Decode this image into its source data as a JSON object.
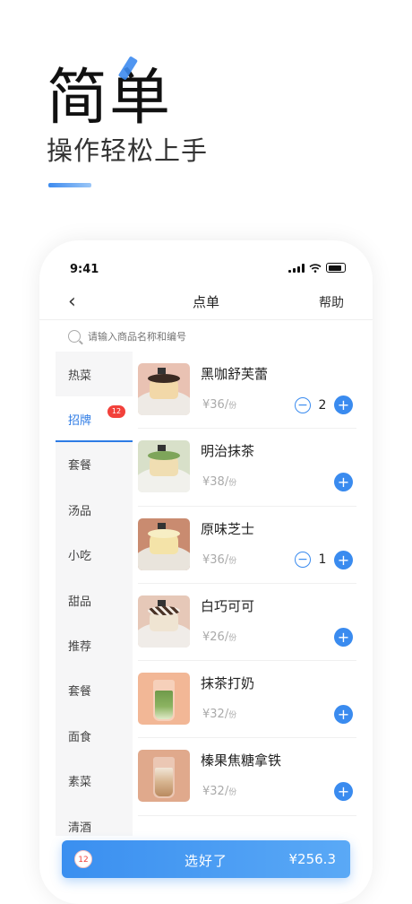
{
  "hero": {
    "title": "简单",
    "subtitle": "操作轻松上手"
  },
  "status": {
    "time": "9:41"
  },
  "nav": {
    "title": "点单",
    "help": "帮助"
  },
  "search": {
    "placeholder": "请输入商品名称和编号"
  },
  "categories": [
    {
      "label": "热菜"
    },
    {
      "label": "招牌",
      "badge": "12",
      "active": true
    },
    {
      "label": "套餐"
    },
    {
      "label": "汤品"
    },
    {
      "label": "小吃"
    },
    {
      "label": "甜品"
    },
    {
      "label": "推荐"
    },
    {
      "label": "套餐"
    },
    {
      "label": "面食"
    },
    {
      "label": "素菜"
    },
    {
      "label": "清酒"
    }
  ],
  "items": [
    {
      "name": "黑咖舒芙蕾",
      "price": "¥36/",
      "unit": "份",
      "qty": "2"
    },
    {
      "name": "明治抹茶",
      "price": "¥38/",
      "unit": "份"
    },
    {
      "name": "原味芝士",
      "price": "¥36/",
      "unit": "份",
      "qty": "1"
    },
    {
      "name": "白巧可可",
      "price": "¥26/",
      "unit": "份"
    },
    {
      "name": "抹茶打奶",
      "price": "¥32/",
      "unit": "份"
    },
    {
      "name": "榛果焦糖拿铁",
      "price": "¥32/",
      "unit": "份"
    }
  ],
  "cart": {
    "count": "12",
    "label": "选好了",
    "total": "¥256.3"
  },
  "colors": {
    "accent": "#3a8bef",
    "badge": "#f2413b"
  }
}
